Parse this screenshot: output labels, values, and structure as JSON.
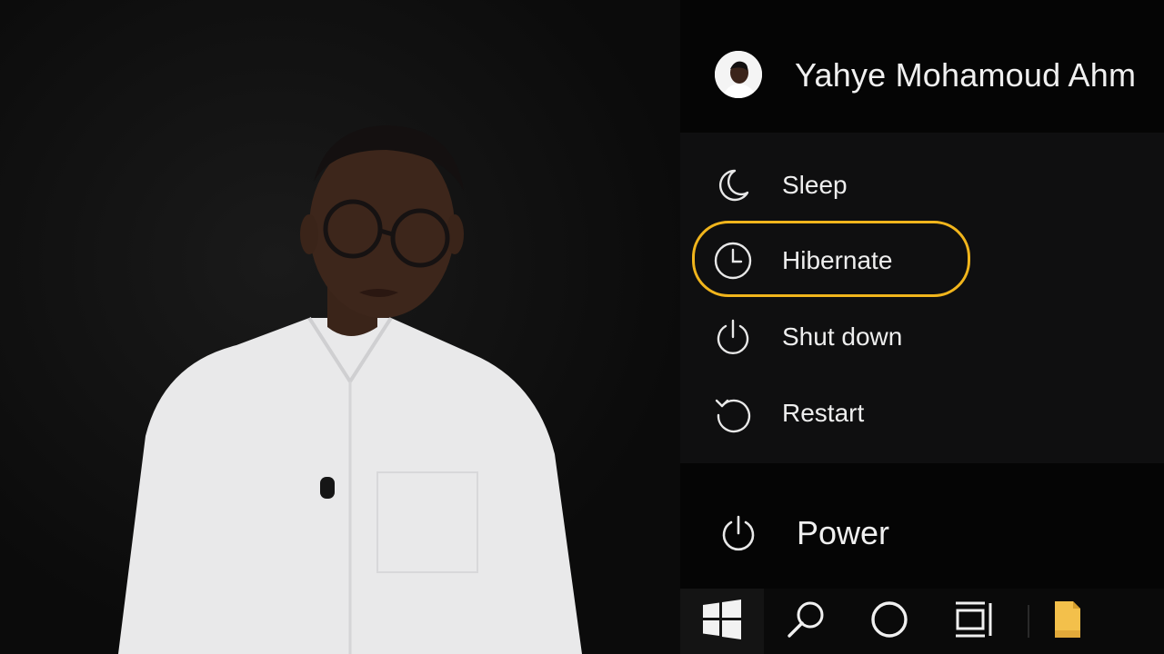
{
  "user": {
    "name": "Yahye Mohamoud Ahm"
  },
  "power_menu": {
    "items": [
      {
        "label": "Sleep",
        "icon": "moon-icon"
      },
      {
        "label": "Hibernate",
        "icon": "clock-icon",
        "highlighted": true
      },
      {
        "label": "Shut down",
        "icon": "power-icon"
      },
      {
        "label": "Restart",
        "icon": "restart-icon"
      }
    ]
  },
  "power_button": {
    "label": "Power",
    "icon": "power-icon"
  },
  "taskbar": {
    "items": [
      {
        "icon": "windows-logo-icon"
      },
      {
        "icon": "search-icon"
      },
      {
        "icon": "cortana-circle-icon"
      },
      {
        "icon": "task-view-icon"
      },
      {
        "icon": "file-explorer-icon"
      }
    ]
  },
  "colors": {
    "highlight": "#f1b51c",
    "menu_bg": "#0f0f10",
    "text": "#eeeeee"
  }
}
